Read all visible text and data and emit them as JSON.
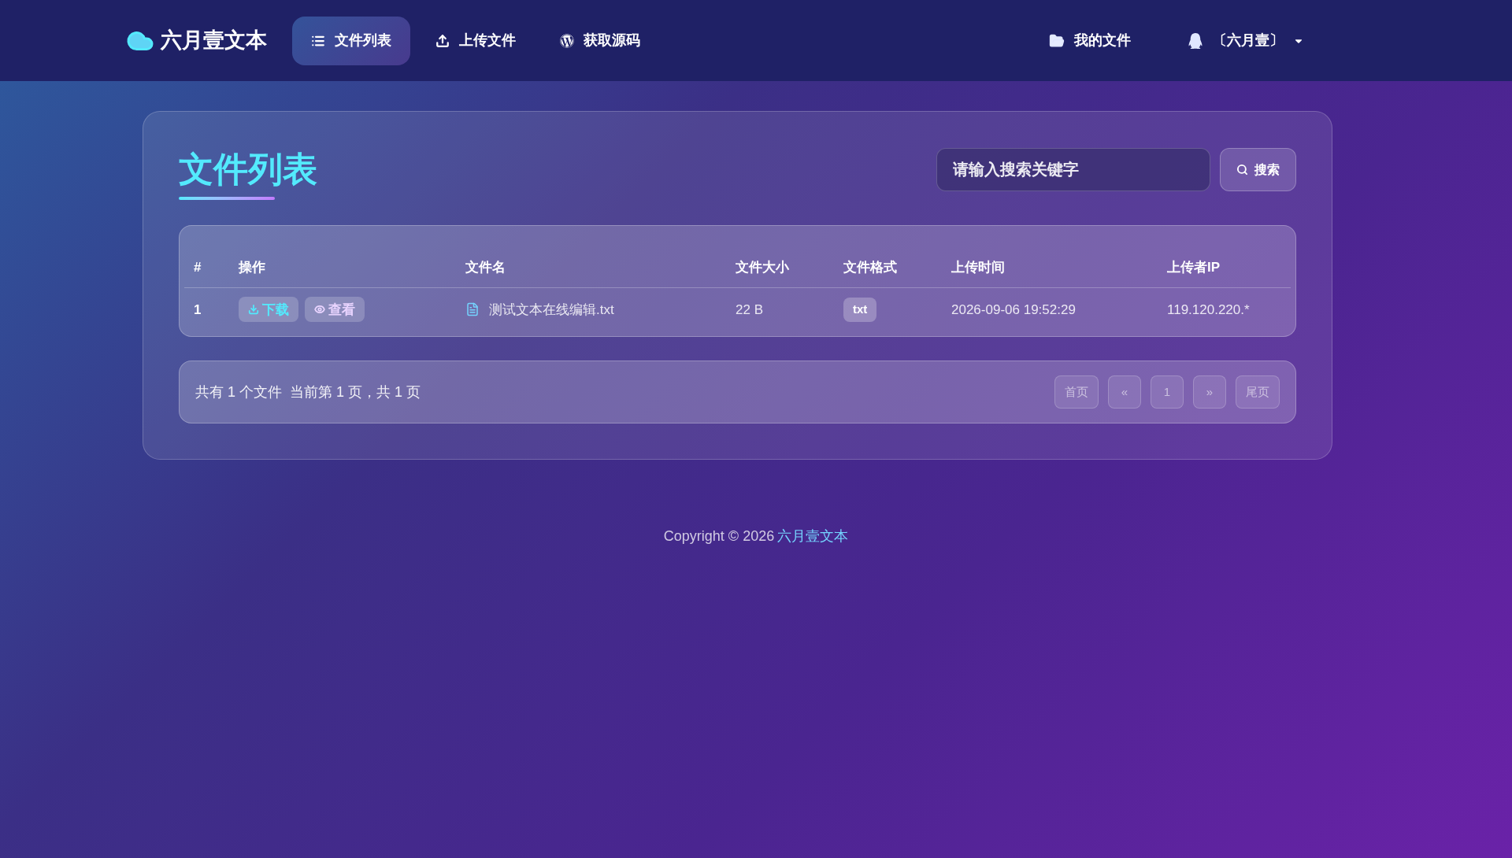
{
  "brand": {
    "name": "六月壹文本"
  },
  "nav": [
    {
      "label": "文件列表",
      "selected": true
    },
    {
      "label": "上传文件",
      "selected": false
    },
    {
      "label": "获取源码",
      "selected": false
    }
  ],
  "nav_right": [
    {
      "label": "我的文件",
      "kind": "link"
    },
    {
      "label": "〔六月壹〕",
      "kind": "dropdown"
    }
  ],
  "page": {
    "title": "文件列表",
    "search": {
      "placeholder": "请输入搜索关键字",
      "button": "搜索"
    }
  },
  "table": {
    "columns": [
      "#",
      "操作",
      "文件名",
      "文件大小",
      "文件格式",
      "上传时间",
      "上传者IP"
    ],
    "rows": [
      {
        "index": "1",
        "actions": [
          "下载",
          "查看"
        ],
        "name": "测试文本在线编辑.txt",
        "size": "22 B",
        "format": "txt",
        "time": "2026-09-06 19:52:29",
        "ip": "119.120.220.*"
      }
    ]
  },
  "pagination": {
    "summary": "共有 1 个文件  当前第 1 页，共 1 页",
    "buttons": [
      {
        "label": "首页",
        "disabled": true
      },
      {
        "label": "«",
        "disabled": true
      },
      {
        "label": "1",
        "disabled": true
      },
      {
        "label": "»",
        "disabled": true
      },
      {
        "label": "尾页",
        "disabled": true
      }
    ]
  },
  "footer": {
    "text": "Copyright © 2026",
    "link": "六月壹文本"
  }
}
